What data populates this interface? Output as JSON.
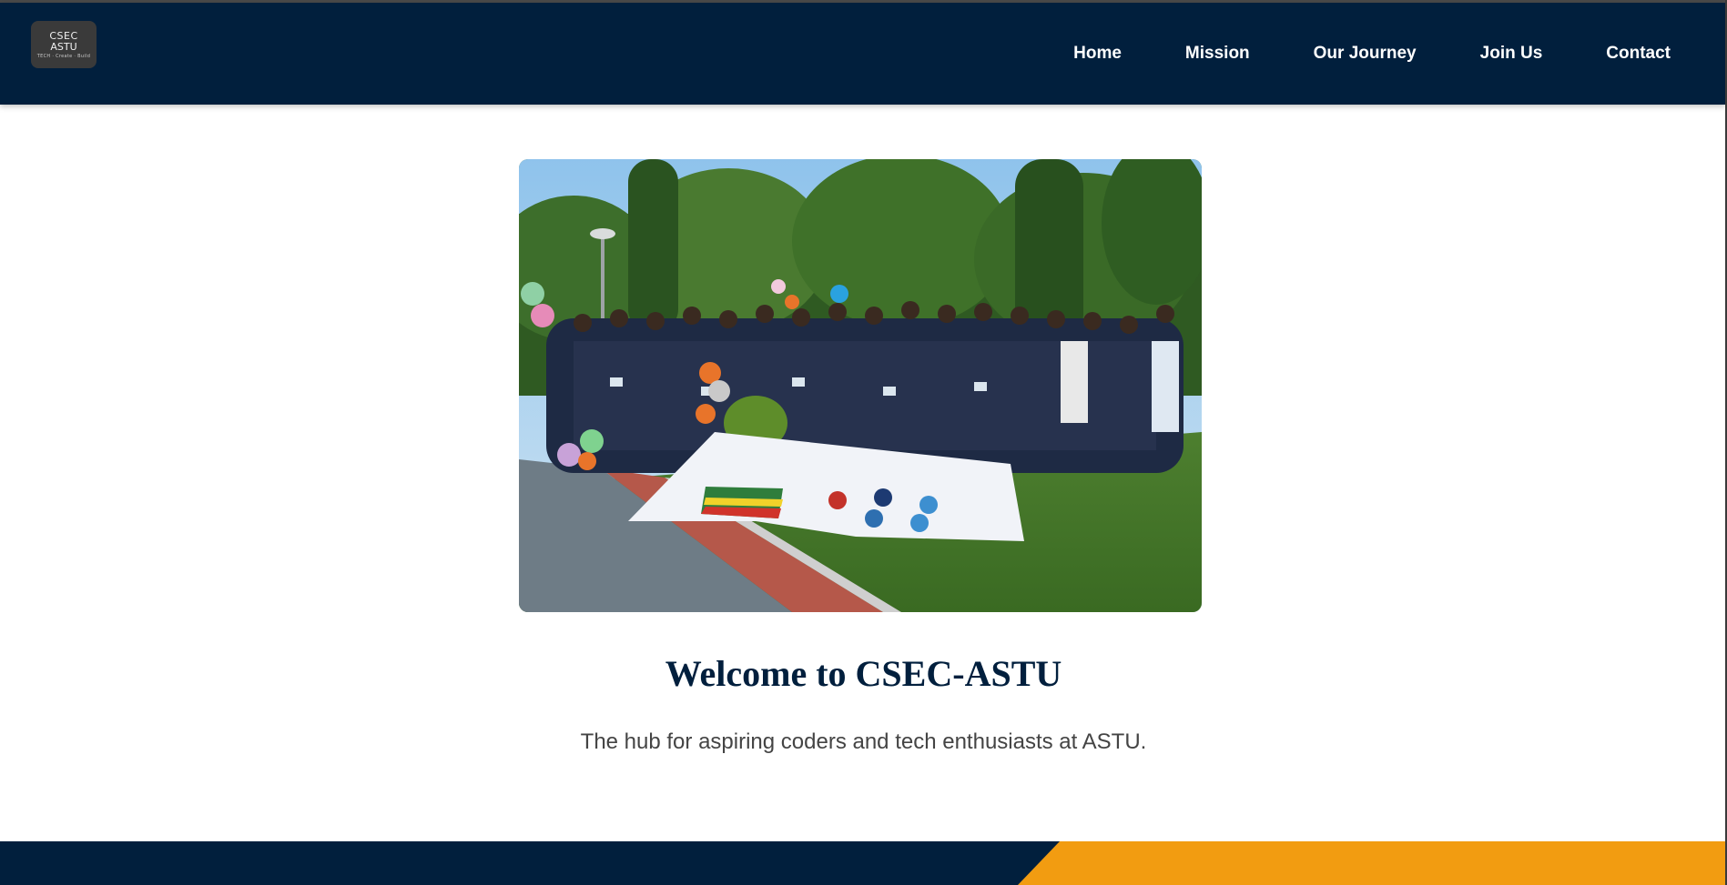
{
  "logo": {
    "line1": "CSEC",
    "line2": "ASTU",
    "tagline": "TECH · Create · Build"
  },
  "nav": {
    "items": [
      {
        "label": "Home"
      },
      {
        "label": "Mission"
      },
      {
        "label": "Our Journey"
      },
      {
        "label": "Join Us"
      },
      {
        "label": "Contact"
      }
    ]
  },
  "hero": {
    "title": "Welcome to CSEC-ASTU",
    "subtitle": "The hub for aspiring coders and tech enthusiasts at ASTU."
  },
  "colors": {
    "navbar": "#011f3d",
    "title": "#011f3d",
    "footer": "#011f3d",
    "footer_accent": "#f29c11"
  }
}
